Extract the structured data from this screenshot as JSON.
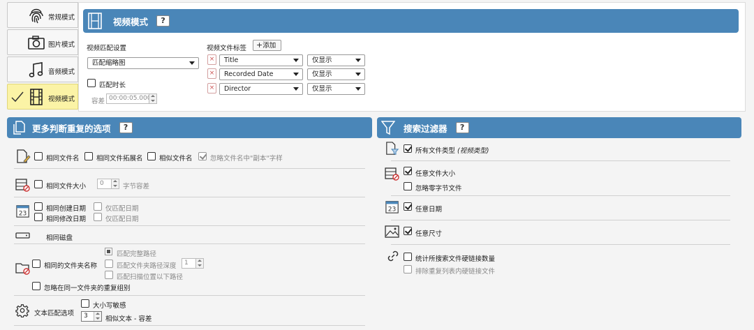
{
  "modes": [
    {
      "label": "常规模式",
      "icon": "fingerprint-icon",
      "active": false
    },
    {
      "label": "图片模式",
      "icon": "camera-icon",
      "active": false
    },
    {
      "label": "音频模式",
      "icon": "music-note-icon",
      "active": false
    },
    {
      "label": "视频模式",
      "icon": "film-icon",
      "active": true
    }
  ],
  "video": {
    "title": "视频模式",
    "help": "?",
    "match_settings_label": "视频匹配设置",
    "match_method": "匹配缩略图",
    "match_duration_label": "匹配时长",
    "tolerance_label": "容差",
    "tolerance_value": "00:00:05.000",
    "tags_label": "视频文件标签",
    "add_label": "添加",
    "tags": [
      {
        "name": "Title",
        "mode": "仅显示"
      },
      {
        "name": "Recorded Date",
        "mode": "仅显示"
      },
      {
        "name": "Director",
        "mode": "仅显示"
      }
    ]
  },
  "duplicate": {
    "title": "更多判断重复的选项",
    "help": "?",
    "same_filename": "相同文件名",
    "same_ext": "相同文件拓展名",
    "similar_filename": "相似文件名",
    "ignore_copy": "忽略文件名中\"副本\"字样",
    "same_size": "相同文件大小",
    "size_value": "0",
    "byte_tolerance": "字节容差",
    "same_created": "相同创建日期",
    "same_modified": "相同修改日期",
    "only_date_1": "仅匹配日期",
    "only_date_2": "仅匹配日期",
    "same_disk": "相同磁盘",
    "same_folder": "相同的文件夹名称",
    "match_full_path": "匹配完整路径",
    "match_path_depth": "匹配文件夹路径深度",
    "depth_value": "1",
    "match_below_scan": "匹配扫描位置以下路径",
    "ignore_same_folder": "忽略在同一文件夹的重复组别",
    "text_match": "文本匹配选项",
    "case_sensitive": "大小写敏感",
    "similar_value": "3",
    "similar_text": "相似文本 - 容差"
  },
  "filter": {
    "title": "搜索过滤器",
    "help": "?",
    "all_types": "所有文件类型",
    "all_types_note": "(视频类型)",
    "any_size": "任意文件大小",
    "ignore_zero": "忽略零字节文件",
    "any_date": "任意日期",
    "any_dimension": "任意尺寸",
    "count_hardlinks": "统计所搜索文件硬链接数量",
    "exclude_hardlinks": "排除重复列表内硬链接文件"
  },
  "colors": {
    "header": "#4a86b8",
    "active_tab": "#fbf3a6"
  }
}
